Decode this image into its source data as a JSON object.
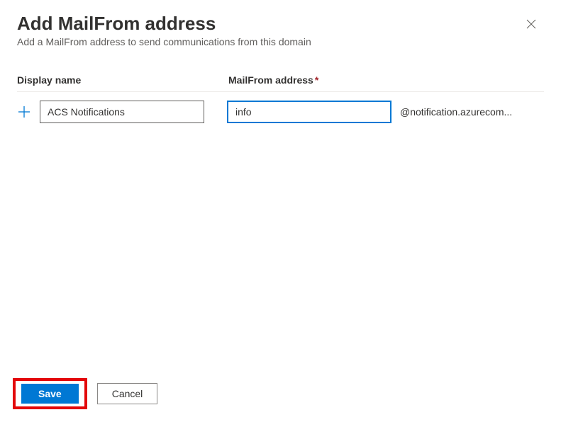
{
  "header": {
    "title": "Add MailFrom address",
    "subtitle": "Add a MailFrom address to send communications from this domain"
  },
  "form": {
    "display_name_label": "Display name",
    "mailfrom_label": "MailFrom address",
    "display_name_value": "ACS Notifications",
    "mailfrom_value": "info",
    "domain_suffix": "@notification.azurecom..."
  },
  "footer": {
    "save_label": "Save",
    "cancel_label": "Cancel"
  }
}
